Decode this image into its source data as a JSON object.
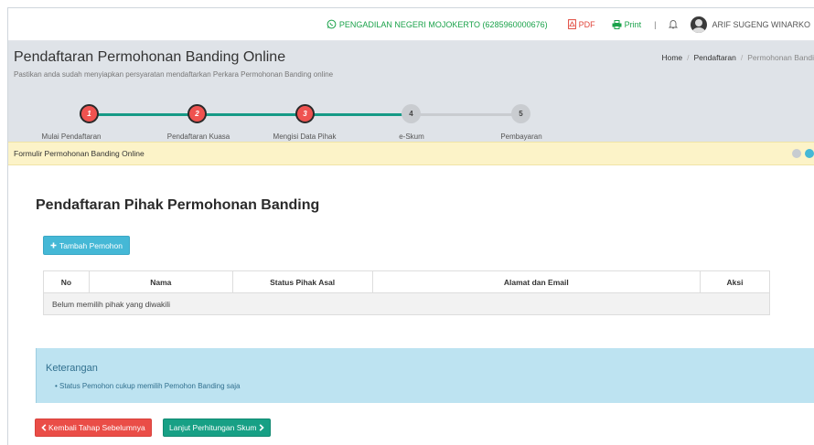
{
  "topbar": {
    "court": "PENGADILAN NEGERI MOJOKERTO (6285960000676)",
    "pdf": "PDF",
    "print": "Print",
    "separator": "|",
    "user": "ARIF SUGENG WINARKO"
  },
  "header": {
    "title": "Pendaftaran Permohonan Banding Online",
    "subtitle": "Pastikan anda sudah menyiapkan persyaratan mendaftarkan Perkara Permohonan Banding online",
    "breadcrumb": [
      "Home",
      "Pendaftaran",
      "Permohonan Bandi"
    ]
  },
  "wizard": {
    "steps": [
      {
        "num": "1",
        "label": "Mulai Pendaftaran",
        "status": "done"
      },
      {
        "num": "2",
        "label": "Pendaftaran Kuasa",
        "status": "done"
      },
      {
        "num": "3",
        "label": "Mengisi Data Pihak",
        "status": "done"
      },
      {
        "num": "4",
        "label": "e-Skum",
        "status": "todo"
      },
      {
        "num": "5",
        "label": "Pembayaran",
        "status": "todo"
      }
    ],
    "colors": {
      "done": "#ef5350",
      "line_done": "#169a86",
      "line_todo": "#c9ccd0"
    }
  },
  "alert": {
    "text": "Formulir Permohonan Banding Online"
  },
  "main": {
    "section_title": "Pendaftaran Pihak Permohonan Banding",
    "add_button": "Tambah Pemohon",
    "table": {
      "headers": [
        "No",
        "Nama",
        "Status Pihak Asal",
        "Alamat dan Email",
        "Aksi"
      ],
      "empty_text": "Belum memilih pihak yang diwakili"
    },
    "info": {
      "title": "Keterangan",
      "items": [
        "Status Pemohon cukup memilih Pemohon Banding saja"
      ]
    },
    "back_button": "Kembali Tahap Sebelumnya",
    "next_button": "Lanjut Perhitungan Skum"
  },
  "icons": {
    "whatsapp": "whatsapp-icon",
    "pdf": "pdf-icon",
    "print": "print-icon",
    "bell": "bell-icon",
    "plus": "plus-icon",
    "chevron_left": "chevron-left-icon",
    "chevron_right": "chevron-right-icon"
  }
}
